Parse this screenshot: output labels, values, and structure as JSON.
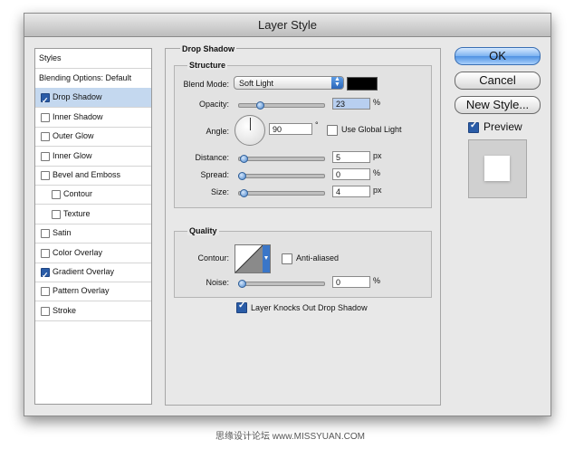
{
  "window": {
    "title": "Layer Style"
  },
  "styles_list": {
    "header": "Styles",
    "items": [
      {
        "label": "Blending Options: Default",
        "checkbox": false,
        "checked": false,
        "indent": 0,
        "selected": false
      },
      {
        "label": "Drop Shadow",
        "checkbox": true,
        "checked": true,
        "indent": 0,
        "selected": true
      },
      {
        "label": "Inner Shadow",
        "checkbox": true,
        "checked": false,
        "indent": 0,
        "selected": false
      },
      {
        "label": "Outer Glow",
        "checkbox": true,
        "checked": false,
        "indent": 0,
        "selected": false
      },
      {
        "label": "Inner Glow",
        "checkbox": true,
        "checked": false,
        "indent": 0,
        "selected": false
      },
      {
        "label": "Bevel and Emboss",
        "checkbox": true,
        "checked": false,
        "indent": 0,
        "selected": false
      },
      {
        "label": "Contour",
        "checkbox": true,
        "checked": false,
        "indent": 1,
        "selected": false
      },
      {
        "label": "Texture",
        "checkbox": true,
        "checked": false,
        "indent": 1,
        "selected": false
      },
      {
        "label": "Satin",
        "checkbox": true,
        "checked": false,
        "indent": 0,
        "selected": false
      },
      {
        "label": "Color Overlay",
        "checkbox": true,
        "checked": false,
        "indent": 0,
        "selected": false
      },
      {
        "label": "Gradient Overlay",
        "checkbox": true,
        "checked": true,
        "indent": 0,
        "selected": false
      },
      {
        "label": "Pattern Overlay",
        "checkbox": true,
        "checked": false,
        "indent": 0,
        "selected": false
      },
      {
        "label": "Stroke",
        "checkbox": true,
        "checked": false,
        "indent": 0,
        "selected": false
      }
    ]
  },
  "drop_shadow": {
    "title": "Drop Shadow",
    "structure": {
      "title": "Structure",
      "blend_mode_label": "Blend Mode:",
      "blend_mode_value": "Soft Light",
      "shadow_color": "#000000",
      "opacity_label": "Opacity:",
      "opacity_value": "23",
      "opacity_unit": "%",
      "opacity_fraction": 0.23,
      "angle_label": "Angle:",
      "angle_value": "90",
      "angle_unit": "°",
      "use_global_light_label": "Use Global Light",
      "use_global_light_checked": false,
      "distance_label": "Distance:",
      "distance_value": "5",
      "distance_unit": "px",
      "distance_fraction": 0.02,
      "spread_label": "Spread:",
      "spread_value": "0",
      "spread_unit": "%",
      "spread_fraction": 0,
      "size_label": "Size:",
      "size_value": "4",
      "size_unit": "px",
      "size_fraction": 0.02
    },
    "quality": {
      "title": "Quality",
      "contour_label": "Contour:",
      "anti_aliased_label": "Anti-aliased",
      "anti_aliased_checked": false,
      "noise_label": "Noise:",
      "noise_value": "0",
      "noise_unit": "%",
      "noise_fraction": 0
    },
    "knockout_label": "Layer Knocks Out Drop Shadow",
    "knockout_checked": true
  },
  "buttons": {
    "ok": "OK",
    "cancel": "Cancel",
    "new_style": "New Style...",
    "preview_label": "Preview",
    "preview_checked": true
  },
  "watermark": "思缘设计论坛 www.MISSYUAN.COM",
  "colors": {
    "accent": "#4f92e3",
    "selection": "#c4d8ef"
  }
}
